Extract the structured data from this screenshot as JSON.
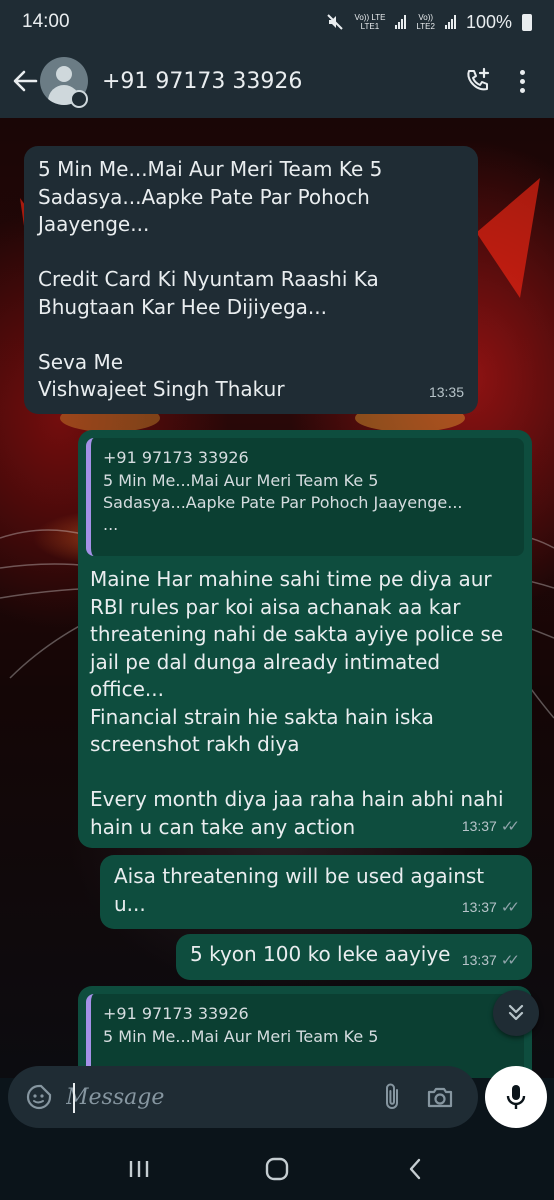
{
  "status_bar": {
    "time": "14:00",
    "net1_top": "Vo)) LTE",
    "net1_bottom": "LTE1",
    "net2_top": "Vo))",
    "net2_bottom": "LTE2",
    "battery": "100%"
  },
  "header": {
    "contact": "+91 97173 33926"
  },
  "messages": [
    {
      "direction": "in",
      "text": "5 Min Me...Mai Aur Meri Team Ke 5\nSadasya...Aapke Pate Par Pohoch\nJaayenge...\n\nCredit Card Ki Nyuntam Raashi Ka\nBhugtaan Kar Hee Dijiyega...\n\nSeva Me\nVishwajeet Singh Thakur",
      "time": "13:35"
    },
    {
      "direction": "out",
      "quote": {
        "author": "+91 97173 33926",
        "text": "5 Min Me...Mai Aur Meri Team Ke 5\nSadasya...Aapke Pate Par Pohoch Jaayenge...\n..."
      },
      "text": "Maine Har mahine sahi time pe diya aur\nRBI rules par koi aisa achanak aa kar\nthreatening nahi de sakta ayiye police se\njail pe dal dunga already intimated\noffice...\nFinancial strain hie sakta hain iska\nscreenshot rakh diya\n\nEvery month diya jaa raha hain abhi nahi\nhain u can take any action",
      "time": "13:37"
    },
    {
      "direction": "out",
      "text": "Aisa threatening will be used against u...",
      "time": "13:37"
    },
    {
      "direction": "out",
      "text": "5 kyon 100 ko leke aayiye",
      "time": "13:37"
    },
    {
      "direction": "out",
      "quote": {
        "author": "+91 97173 33926",
        "text": "5 Min Me...Mai Aur Meri Team Ke 5"
      },
      "text": "",
      "time": ""
    }
  ],
  "input": {
    "placeholder": "Message"
  },
  "colors": {
    "incoming_bubble": "#1f2c34",
    "outgoing_bubble": "#0e4d3e",
    "quote_bar": "#a591e8",
    "header": "#1f2c34"
  },
  "icons": [
    "back-arrow-icon",
    "add-call-icon",
    "more-vertical-icon",
    "emoji-sticker-icon",
    "paperclip-icon",
    "camera-icon",
    "mic-icon",
    "double-check-icon",
    "chevron-double-down-icon",
    "nav-recents-icon",
    "nav-home-icon",
    "nav-back-icon",
    "mute-icon"
  ]
}
